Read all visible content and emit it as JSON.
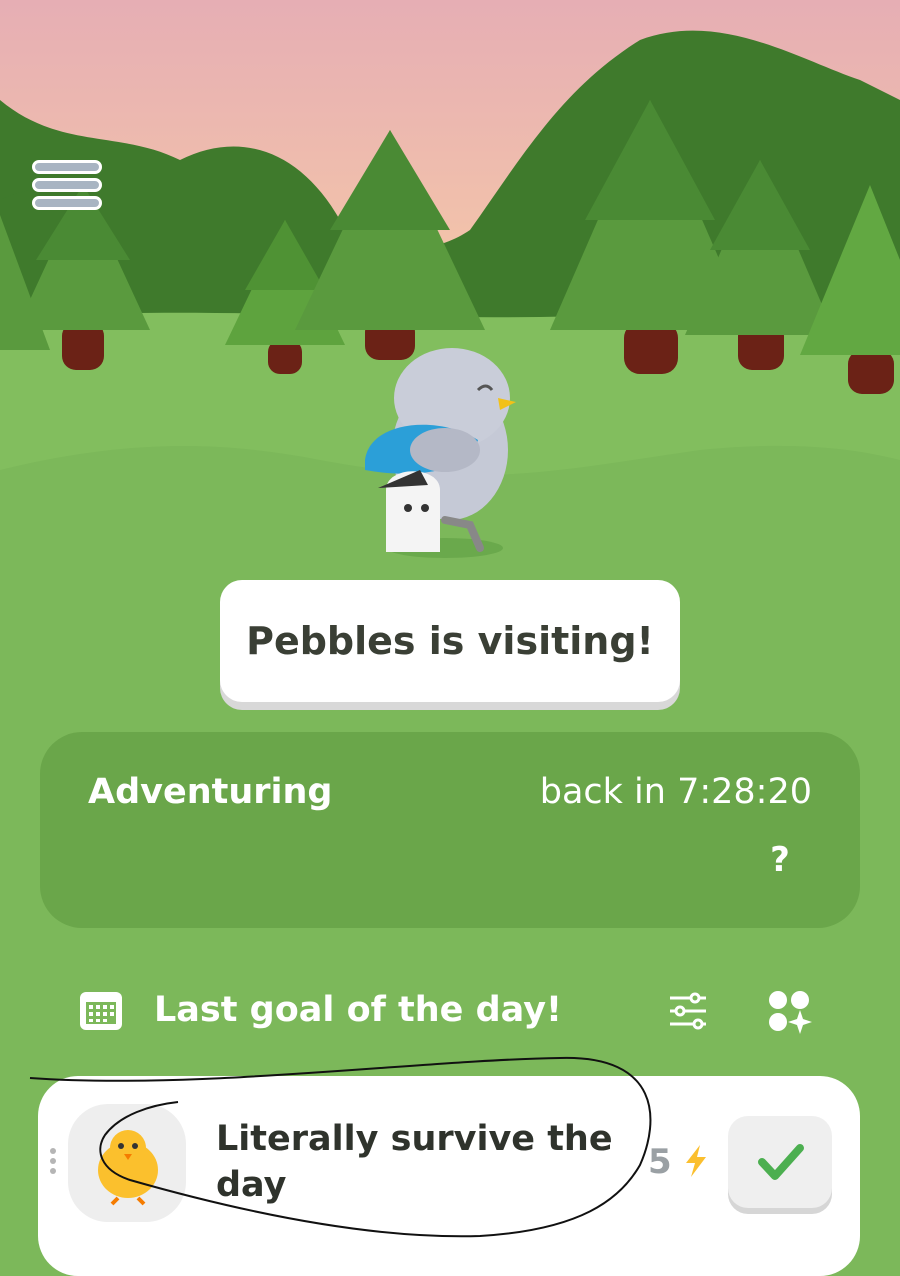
{
  "visitor": {
    "banner_text": "Pebbles is visiting!"
  },
  "adventure": {
    "title": "Adventuring",
    "time_text": "back in 7:28:20",
    "mystery_label": "?"
  },
  "goals": {
    "header": "Last goal of the day!",
    "items": [
      {
        "text_line1": "Literally survive the",
        "text_line2": "day",
        "points": "5"
      }
    ]
  },
  "icons": {
    "menu": "hamburger-menu-icon",
    "calendar": "calendar-icon",
    "filter": "sliders-icon",
    "widgets": "widgets-sparkle-icon",
    "energy": "lightning-icon",
    "check": "checkmark-icon"
  },
  "colors": {
    "sky_top": "#e8b0b4",
    "sky_bottom": "#f6c8a8",
    "grass": "#7cb85a",
    "hill_dark": "#3f7a2c",
    "energy": "#fbbf2e",
    "check": "#4caf50"
  }
}
